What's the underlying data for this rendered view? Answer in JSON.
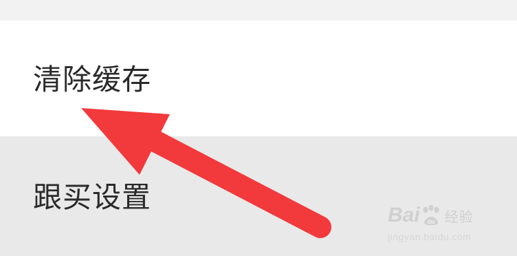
{
  "settings": {
    "items": [
      {
        "label": "清除缓存"
      },
      {
        "label": "跟买设置"
      }
    ]
  },
  "annotation": {
    "icon": "arrow-icon",
    "color": "#f2393b"
  },
  "watermark": {
    "brand_left": "Bai",
    "brand_right": "du",
    "suffix": "经验",
    "url": "jingyan.baidu.com"
  }
}
